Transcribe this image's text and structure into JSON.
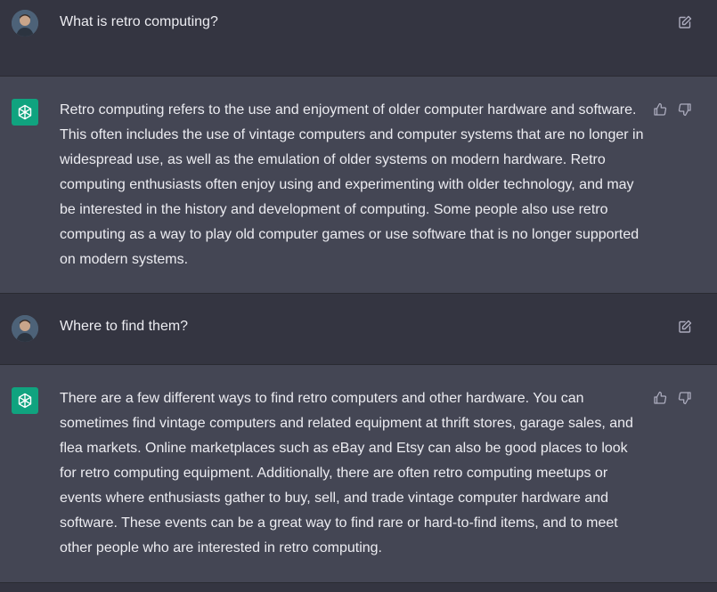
{
  "messages": [
    {
      "role": "user",
      "text": "What is retro computing?",
      "action_icon": "edit-icon"
    },
    {
      "role": "assistant",
      "text": "Retro computing refers to the use and enjoyment of older computer hardware and software. This often includes the use of vintage computers and computer systems that are no longer in widespread use, as well as the emulation of older systems on modern hardware. Retro computing enthusiasts often enjoy using and experimenting with older technology, and may be interested in the history and development of computing. Some people also use retro computing as a way to play old computer games or use software that is no longer supported on modern systems.",
      "action_icons": [
        "thumbs-up-icon",
        "thumbs-down-icon"
      ]
    },
    {
      "role": "user",
      "text": "Where to find them?",
      "action_icon": "edit-icon"
    },
    {
      "role": "assistant",
      "text": "There are a few different ways to find retro computers and other hardware. You can sometimes find vintage computers and related equipment at thrift stores, garage sales, and flea markets. Online marketplaces such as eBay and Etsy can also be good places to look for retro computing equipment. Additionally, there are often retro computing meetups or events where enthusiasts gather to buy, sell, and trade vintage computer hardware and software. These events can be a great way to find rare or hard-to-find items, and to meet other people who are interested in retro computing.",
      "action_icons": [
        "thumbs-up-icon",
        "thumbs-down-icon"
      ]
    }
  ],
  "colors": {
    "user_bg": "#343541",
    "assistant_bg": "#444654",
    "text": "#ececf1",
    "icon": "#acacbe",
    "brand": "#10a37f"
  }
}
